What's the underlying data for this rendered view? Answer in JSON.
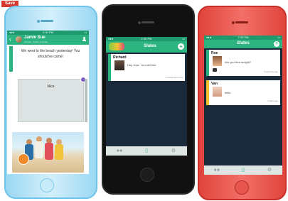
{
  "badge": "Save",
  "status": {
    "time": "2:30 PM"
  },
  "chat": {
    "contact_name": "Jamie Sue",
    "contact_sub": "Current · Active 1 minute",
    "back_icon": "back-arrow-icon",
    "profile_icon": "person-icon",
    "message_1": "We went to the beach yesterday! You should've came!",
    "message_2": "Nice"
  },
  "slates_1": {
    "title": "Slates",
    "add_icon": "plus-icon",
    "logo": "Slates logo",
    "items": [
      {
        "name": "Richard",
        "message": "Hey Jose. You still free",
        "time": "1 minute from now",
        "color": "#2db37f"
      }
    ],
    "tabs": [
      "friends-icon",
      "trash-icon",
      "settings-icon"
    ]
  },
  "slates_2": {
    "title": "Slates",
    "add_icon": "plus-icon",
    "items": [
      {
        "name": "Roe",
        "message": "Are you free tonight?",
        "time": "3 seconds ago",
        "color": "#2db37f"
      },
      {
        "name": "Van",
        "message": "hello",
        "time": "3 days ago",
        "color": "#f2c230"
      }
    ],
    "tabs": [
      "friends-icon",
      "trash-icon",
      "settings-icon"
    ]
  },
  "colors": {
    "accent_green": "#2db37f",
    "dark_screen": "#1b2a3a",
    "yellow": "#f2c230",
    "blue_phone": "#9ad8f2",
    "red_phone": "#e0443c"
  }
}
